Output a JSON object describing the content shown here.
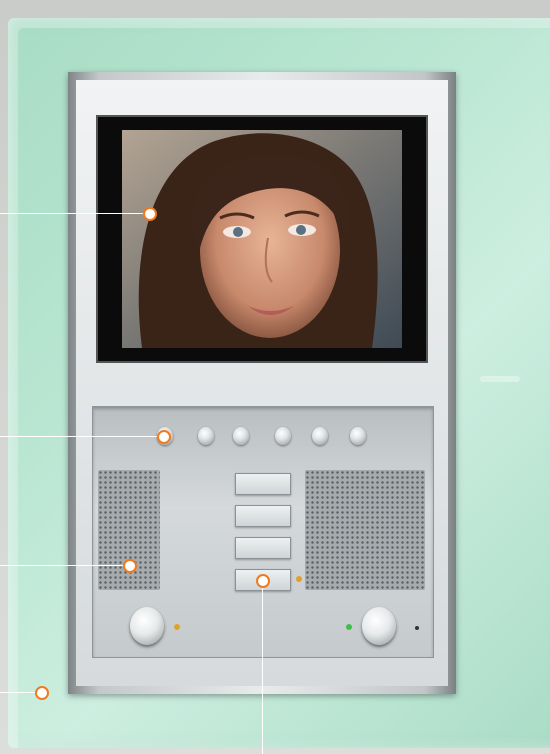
{
  "image": {
    "subject": "",
    "colors": {
      "glass_plate": "#b9e6d2",
      "frame": "#dfe3e5",
      "screen_bezel": "#0b0b0b",
      "callout_accent": "#f07a1e",
      "led_amber": "#e2a02a",
      "led_green": "#3fbf4a"
    }
  },
  "device": {
    "screen": {
      "label": ""
    },
    "top_buttons": {
      "count": 6
    },
    "keys": {
      "count": 4
    },
    "knobs": {
      "count": 2
    }
  },
  "callouts": [
    {
      "name": "screen-callout"
    },
    {
      "name": "buttons-callout"
    },
    {
      "name": "speaker-callout"
    },
    {
      "name": "frame-callout"
    },
    {
      "name": "key-callout"
    }
  ]
}
